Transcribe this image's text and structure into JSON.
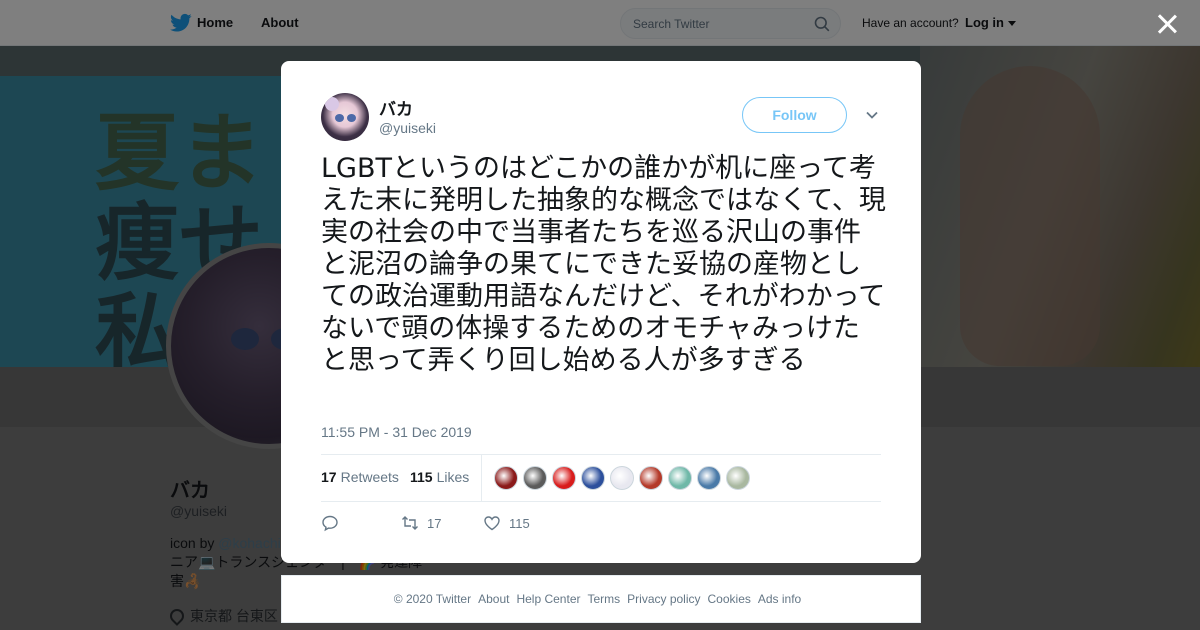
{
  "topbar": {
    "home_label": "Home",
    "about_label": "About",
    "search_placeholder": "Search Twitter",
    "account_prompt": "Have an account?",
    "login_label": "Log in"
  },
  "banner": {
    "text_line1": "夏ま",
    "text_line2": "痩せ",
    "text_line3": "私"
  },
  "profile": {
    "name": "バカ",
    "handle": "@yuiseki",
    "bio_prefix": "icon by ",
    "bio_link": "@kohachi",
    "bio_line2": "ニア💻トランスジェンダ　|　🌈 発達障",
    "bio_line3": "害🦂",
    "location": "東京都 台東区"
  },
  "tweet": {
    "name": "バカ",
    "handle": "@yuiseki",
    "follow_label": "Follow",
    "text": "LGBTというのはどこかの誰かが机に座って考えた末に発明した抽象的な概念ではなくて、現実の社会の中で当事者たちを巡る沢山の事件と泥沼の論争の果てにできた妥協の産物としての政治運動用語なんだけど、それがわかってないで頭の体操するためのオモチャみっけたと思って弄くり回し始める人が多すぎる",
    "timestamp": "11:55 PM - 31 Dec 2019",
    "retweets_count": "17",
    "retweets_label": "Retweets",
    "likes_count": "115",
    "likes_label": "Likes",
    "action_retweet_count": "17",
    "action_like_count": "115",
    "likers": [
      {
        "color": "#8b1a1a",
        "icon": "liker-avatar"
      },
      {
        "color": "#5b5b5b",
        "icon": "liker-avatar"
      },
      {
        "color": "#d81c1c",
        "icon": "liker-avatar"
      },
      {
        "color": "#2c4f9c",
        "icon": "liker-avatar"
      },
      {
        "color": "#e8e8f0",
        "icon": "liker-avatar"
      },
      {
        "color": "#b43a2a",
        "icon": "liker-avatar"
      },
      {
        "color": "#6fb8a8",
        "icon": "liker-avatar"
      },
      {
        "color": "#4a7aa8",
        "icon": "liker-avatar"
      },
      {
        "color": "#a9b8a0",
        "icon": "liker-avatar"
      }
    ]
  },
  "footer": {
    "copyright": "© 2020 Twitter",
    "about": "About",
    "help": "Help Center",
    "terms": "Terms",
    "privacy": "Privacy policy",
    "cookies": "Cookies",
    "ads": "Ads info"
  },
  "colors": {
    "brand": "#1da1f2",
    "overlay": "rgba(0,0,0,0.5)",
    "muted_text": "#657786"
  }
}
